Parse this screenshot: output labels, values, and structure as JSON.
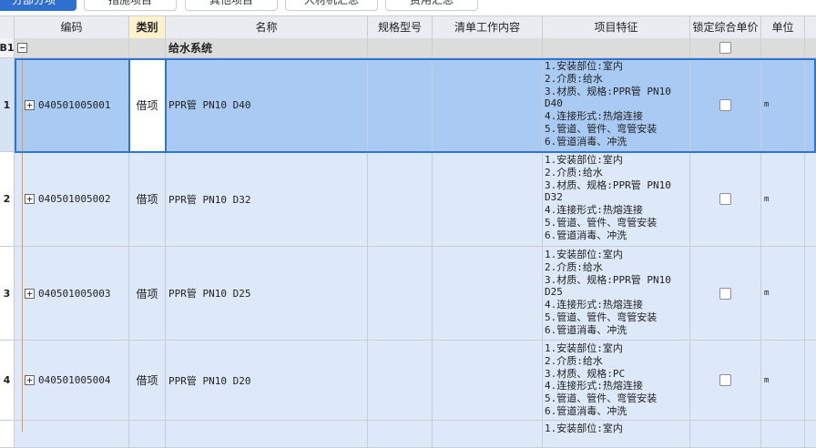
{
  "tabs": [
    {
      "label": "分部分项",
      "active": true
    },
    {
      "label": "措施项目",
      "active": false
    },
    {
      "label": "其他项目",
      "active": false
    },
    {
      "label": "人材机汇总",
      "active": false
    },
    {
      "label": "费用汇总",
      "active": false
    }
  ],
  "columns": {
    "code": "编码",
    "type": "类别",
    "name": "名称",
    "spec": "规格型号",
    "work": "清单工作内容",
    "feature": "项目特征",
    "lock": "锁定综合单价",
    "unit": "单位"
  },
  "group": {
    "num": "B1",
    "expander": "−",
    "name": "给水系统",
    "locked": false
  },
  "rows": [
    {
      "num": "1",
      "code": "040501005001",
      "type": "借项",
      "name": "PPR管 PN10 D40",
      "feature": "1.安装部位:室内\n2.介质:给水\n3.材质、规格:PPR管 PN10\nD40\n4.连接形式:热熔连接\n5.管道、管件、弯管安装\n6.管道消毒、冲洗",
      "locked": false,
      "unit": "m",
      "selected": true
    },
    {
      "num": "2",
      "code": "040501005002",
      "type": "借项",
      "name": "PPR管 PN10 D32",
      "feature": "1.安装部位:室内\n2.介质:给水\n3.材质、规格:PPR管 PN10\nD32\n4.连接形式:热熔连接\n5.管道、管件、弯管安装\n6.管道消毒、冲洗",
      "locked": false,
      "unit": "m",
      "selected": false
    },
    {
      "num": "3",
      "code": "040501005003",
      "type": "借项",
      "name": "PPR管 PN10 D25",
      "feature": "1.安装部位:室内\n2.介质:给水\n3.材质、规格:PPR管 PN10\nD25\n4.连接形式:热熔连接\n5.管道、管件、弯管安装\n6.管道消毒、冲洗",
      "locked": false,
      "unit": "m",
      "selected": false
    },
    {
      "num": "4",
      "code": "040501005004",
      "type": "借项",
      "name": "PPR管 PN10 D20",
      "feature": "1.安装部位:室内\n2.介质:给水\n3.材质、规格:PC\n4.连接形式:热熔连接\n5.管道、管件、弯管安装\n6.管道消毒、冲洗",
      "locked": false,
      "unit": "m",
      "selected": false
    },
    {
      "num": "",
      "code": "",
      "type": "",
      "name": "",
      "feature": "1.安装部位:室内",
      "locked": false,
      "unit": "",
      "selected": false
    }
  ],
  "expander_plus": "+",
  "colors": {
    "selected_row": "#a9caf3",
    "normal_row": "#dde9f8",
    "accent": "#2e73d6",
    "header_highlight": "#fff2cc"
  }
}
